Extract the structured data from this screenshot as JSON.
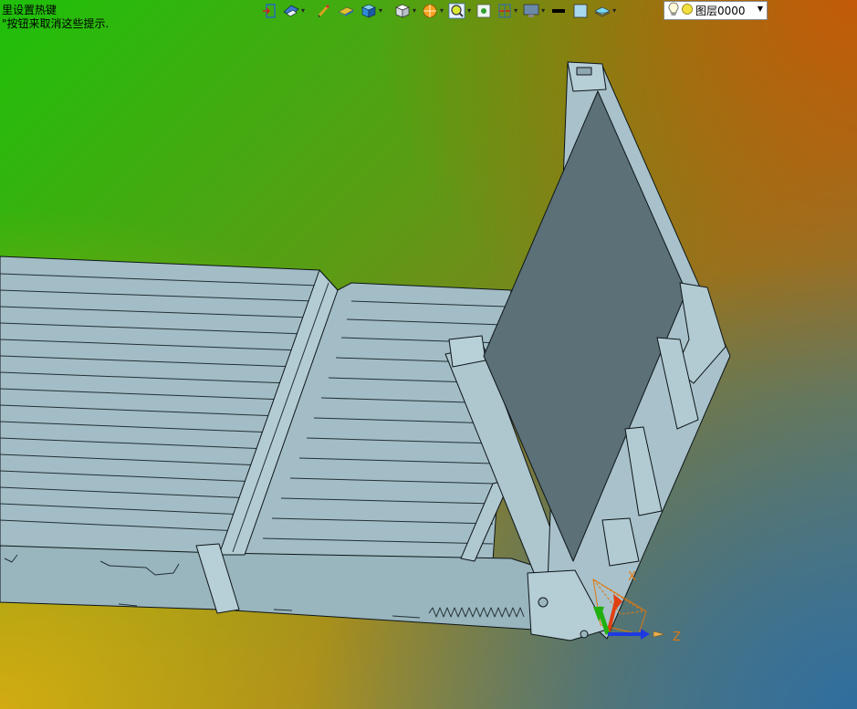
{
  "hints": {
    "line1": "里设置热键",
    "line2": "\"按钮来取消这些提示."
  },
  "toolbar": {
    "buttons": [
      {
        "name": "exit-sketch-icon",
        "dropdown": false
      },
      {
        "name": "view-orient-icon",
        "dropdown": true
      },
      {
        "name": "pencil-icon",
        "dropdown": false
      },
      {
        "name": "plane-icon",
        "dropdown": false
      },
      {
        "name": "solid-box-icon",
        "dropdown": true
      },
      {
        "name": "view-cube-icon",
        "dropdown": true
      },
      {
        "name": "render-style-icon",
        "dropdown": true
      },
      {
        "name": "zoom-icon",
        "dropdown": true
      },
      {
        "name": "fit-view-icon",
        "dropdown": false
      },
      {
        "name": "section-icon",
        "dropdown": true
      },
      {
        "name": "display-icon",
        "dropdown": true
      },
      {
        "name": "line-color-icon",
        "dropdown": false
      },
      {
        "name": "fill-color-icon",
        "dropdown": false
      },
      {
        "name": "layer-tool-icon",
        "dropdown": true
      }
    ]
  },
  "layer": {
    "name": "图层0000"
  },
  "triad": {
    "x_label": "X",
    "z_label": "Z"
  },
  "colors": {
    "part_fill": "#a3bdc6",
    "part_edge": "#0d1518",
    "panel_dark": "#5c7078",
    "axis_x": "#e04010",
    "axis_y": "#22b010",
    "axis_z": "#1d3ae0",
    "label_orange": "#e07810"
  }
}
